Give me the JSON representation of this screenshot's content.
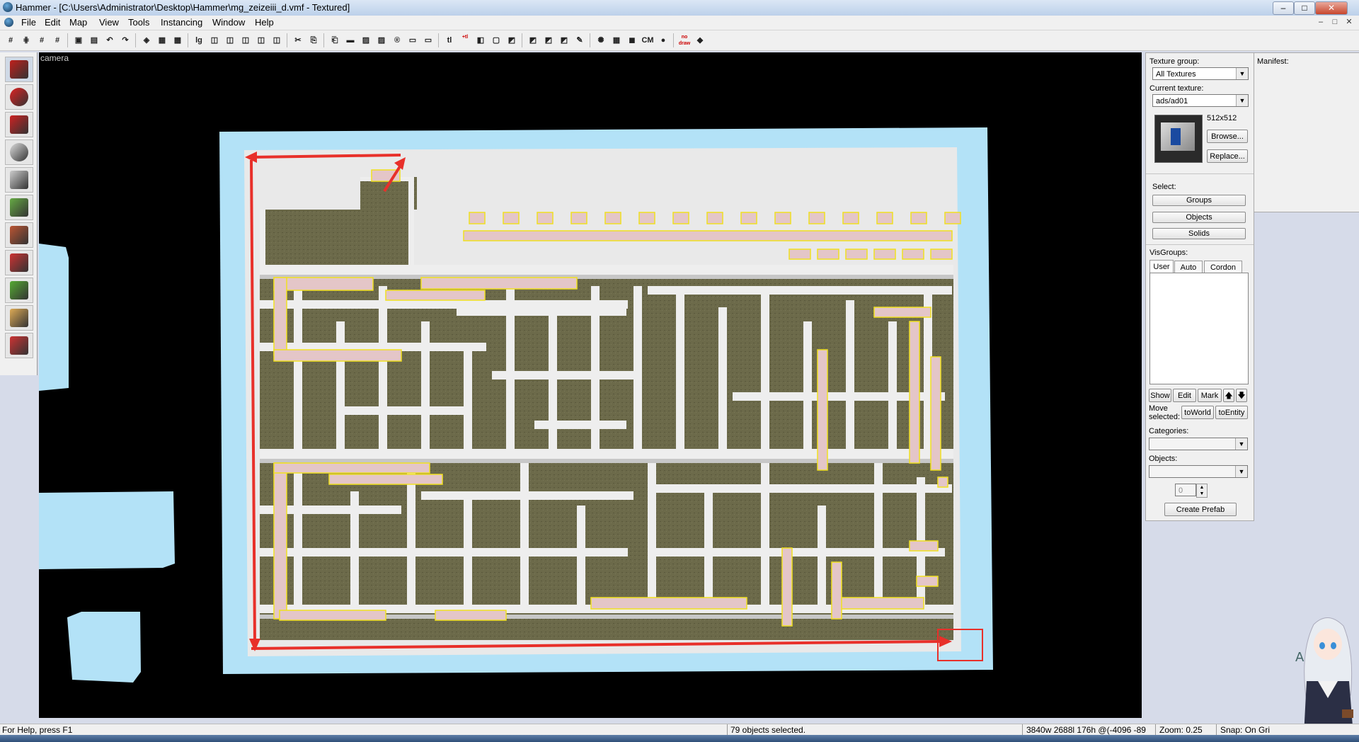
{
  "window": {
    "title": "Hammer - [C:\\Users\\Administrator\\Desktop\\Hammer\\mg_zeizeiii_d.vmf - Textured]",
    "min": "–",
    "max": "□",
    "close": "✕",
    "mdi_min": "–",
    "mdi_max": "□",
    "mdi_close": "✕"
  },
  "menu": [
    "File",
    "Edit",
    "Map",
    "View",
    "Tools",
    "Instancing",
    "Window",
    "Help"
  ],
  "toolbar_glyphs": [
    "#",
    "⋕",
    "#",
    "#",
    "▣",
    "▤",
    "↶",
    "↷",
    "◈",
    "▦",
    "▩",
    "lg",
    "◫",
    "◫",
    "◫",
    "◫",
    "◫",
    "✂",
    "⎘",
    "⎗",
    "▬",
    "▨",
    "▨",
    "®",
    "▭",
    "▭",
    "tl",
    "+tl",
    "◧",
    "▢",
    "◩",
    "◩",
    "◩",
    "◩",
    "✎",
    "✺",
    "▦",
    "◼",
    "CM",
    "●",
    "no draw",
    "◆"
  ],
  "left_tools": [
    {
      "name": "selection-tool-icon",
      "color": "#c0201c"
    },
    {
      "name": "magnify-tool-icon",
      "color": "#d22"
    },
    {
      "name": "camera-tool-icon",
      "color": "#c22"
    },
    {
      "name": "entity-tool-icon",
      "color": "#ddd"
    },
    {
      "name": "block-tool-icon",
      "color": "#ccc"
    },
    {
      "name": "texture-application-icon",
      "color": "#6a4"
    },
    {
      "name": "apply-texture-icon",
      "color": "#b53"
    },
    {
      "name": "decal-tool-icon",
      "color": "#c33"
    },
    {
      "name": "overlay-tool-icon",
      "color": "#5a3"
    },
    {
      "name": "clipping-tool-icon",
      "color": "#da5"
    },
    {
      "name": "vertex-tool-icon",
      "color": "#c33"
    }
  ],
  "viewport": {
    "label": "camera"
  },
  "texture_panel": {
    "group_label": "Texture group:",
    "group_value": "All Textures",
    "current_label": "Current texture:",
    "current_value": "ads/ad01",
    "size": "512x512",
    "browse": "Browse...",
    "replace": "Replace..."
  },
  "select_panel": {
    "label": "Select:",
    "groups": "Groups",
    "objects": "Objects",
    "solids": "Solids"
  },
  "visgroups": {
    "label": "VisGroups:",
    "tabs": [
      "User",
      "Auto",
      "Cordon"
    ],
    "show": "Show",
    "edit": "Edit",
    "mark": "Mark",
    "up": "🡅",
    "down": "🡇"
  },
  "move_selected": {
    "label": "Move\nselected:",
    "to_world": "toWorld",
    "to_entity": "toEntity"
  },
  "categories": {
    "label": "Categories:"
  },
  "objects_panel": {
    "label": "Objects:",
    "spin_value": "0",
    "create_prefab": "Create Prefab"
  },
  "manifest": {
    "label": "Manifest:"
  },
  "status": {
    "help": "For Help, press F1",
    "selected": "79 objects selected.",
    "dims": "3840w 2688l 176h @(-4096 -89",
    "zoom": "Zoom: 0.25",
    "snap": "Snap: On Gri"
  },
  "colors": {
    "sky": "#b3e2f7",
    "floor": "#6c6a4a",
    "wall": "#eeeeee",
    "selection": "#f0e020",
    "annotation": "#e8302a"
  }
}
